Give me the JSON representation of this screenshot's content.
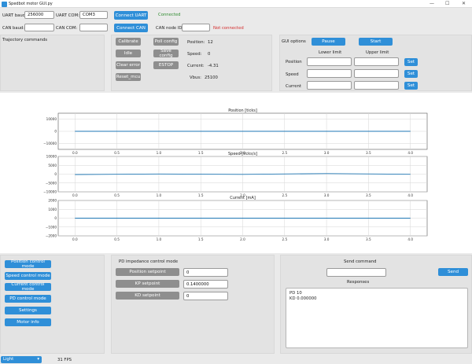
{
  "window": {
    "title": "Spedbot motor GUI.py",
    "min": "—",
    "max": "☐",
    "close": "✕"
  },
  "connection": {
    "uart_baud_label": "UART baud:",
    "uart_baud_value": "256000",
    "uart_com_label": "UART COM:",
    "uart_com_value": "COM3",
    "connect_uart": "Connect UART",
    "uart_status": "Connected",
    "uart_status_color": "#2e8b2e",
    "can_baud_label": "CAN baud:",
    "can_baud_value": "",
    "can_com_label": "CAN COM:",
    "can_com_value": "",
    "connect_can": "Connect CAN",
    "can_node_label": "CAN node ID:",
    "can_node_value": "",
    "can_status": "Not connected",
    "can_status_color": "#d42a2a"
  },
  "trajectory": {
    "title": "Trajectory commands"
  },
  "commands": {
    "calibrate": "Calibrate",
    "idle": "Idle",
    "clear_error": "Clear error",
    "reset_mcu": "Reset_mcu",
    "poll_config": "Poll config",
    "save_config": "Save config",
    "estop": "ESTOP"
  },
  "readouts": {
    "position_label": "Position:",
    "position_value": "12",
    "speed_label": "Speed:",
    "speed_value": "0",
    "current_label": "Current:",
    "current_value": "-4.31",
    "vbus_label": "Vbus:",
    "vbus_value": "25100"
  },
  "gui_options": {
    "title": "GUI options",
    "pause": "Pause",
    "start": "Start",
    "lower_limit": "Lower limit",
    "upper_limit": "Upper limit",
    "rows": [
      {
        "label": "Position",
        "lower": "",
        "upper": "",
        "set": "Set"
      },
      {
        "label": "Speed",
        "lower": "",
        "upper": "",
        "set": "Set"
      },
      {
        "label": "Current",
        "lower": "",
        "upper": "",
        "set": "Set"
      }
    ]
  },
  "chart_data": [
    {
      "type": "line",
      "title": "Position [ticks]",
      "x": [
        0.0,
        4.0
      ],
      "y": [
        0,
        0
      ],
      "xlim": [
        -0.2,
        4.2
      ],
      "ylim": [
        -15000,
        15000
      ],
      "xticks": [
        "0.0",
        "0.5",
        "1.0",
        "1.5",
        "2.0",
        "2.5",
        "3.0",
        "3.5",
        "4.0"
      ],
      "yticks": [
        "10000",
        "0",
        "−10000"
      ],
      "ytick_values": [
        10000,
        0,
        -10000
      ],
      "grid": true,
      "color": "#1f77b4"
    },
    {
      "type": "line",
      "title": "Speed [ticks/s]",
      "x": [
        0.0,
        1.0,
        2.0,
        3.0,
        4.0
      ],
      "y": [
        -200,
        100,
        -150,
        300,
        -100
      ],
      "xlim": [
        -0.2,
        4.2
      ],
      "ylim": [
        -10000,
        10000
      ],
      "xticks": [
        "0.0",
        "0.5",
        "1.0",
        "1.5",
        "2.0",
        "2.5",
        "3.0",
        "3.5",
        "4.0"
      ],
      "yticks": [
        "10000",
        "5000",
        "0",
        "−5000",
        "−10000"
      ],
      "ytick_values": [
        10000,
        5000,
        0,
        -5000,
        -10000
      ],
      "grid": true,
      "color": "#1f77b4"
    },
    {
      "type": "line",
      "title": "Current [mA]",
      "x": [
        0.0,
        4.0
      ],
      "y": [
        -4,
        -4
      ],
      "xlim": [
        -0.2,
        4.2
      ],
      "ylim": [
        -2000,
        2000
      ],
      "xticks": [
        "0.0",
        "0.5",
        "1.0",
        "1.5",
        "2.0",
        "2.5",
        "3.0",
        "3.5",
        "4.0"
      ],
      "yticks": [
        "2000",
        "1000",
        "0",
        "−1000",
        "−2000"
      ],
      "ytick_values": [
        2000,
        1000,
        0,
        -1000,
        -2000
      ],
      "grid": true,
      "color": "#1f77b4"
    }
  ],
  "modes": {
    "items": [
      "Position control mode",
      "Speed control mode",
      "Current control mode",
      "PD control mode",
      "Settings",
      "Motor info"
    ]
  },
  "pd": {
    "title": "PD impedance control mode",
    "rows": [
      {
        "label": "Position setpoint",
        "value": "0"
      },
      {
        "label": "KP setpoint",
        "value": "0.1400000"
      },
      {
        "label": "KD setpoint",
        "value": "0"
      }
    ]
  },
  "send": {
    "title": "Send command",
    "value": "",
    "button": "Send",
    "responses_title": "Responses",
    "responses_line1": "PD 10",
    "responses_line2": "KD 0.000000"
  },
  "status_bar": {
    "theme": "Light",
    "fps": "31 FPS"
  }
}
